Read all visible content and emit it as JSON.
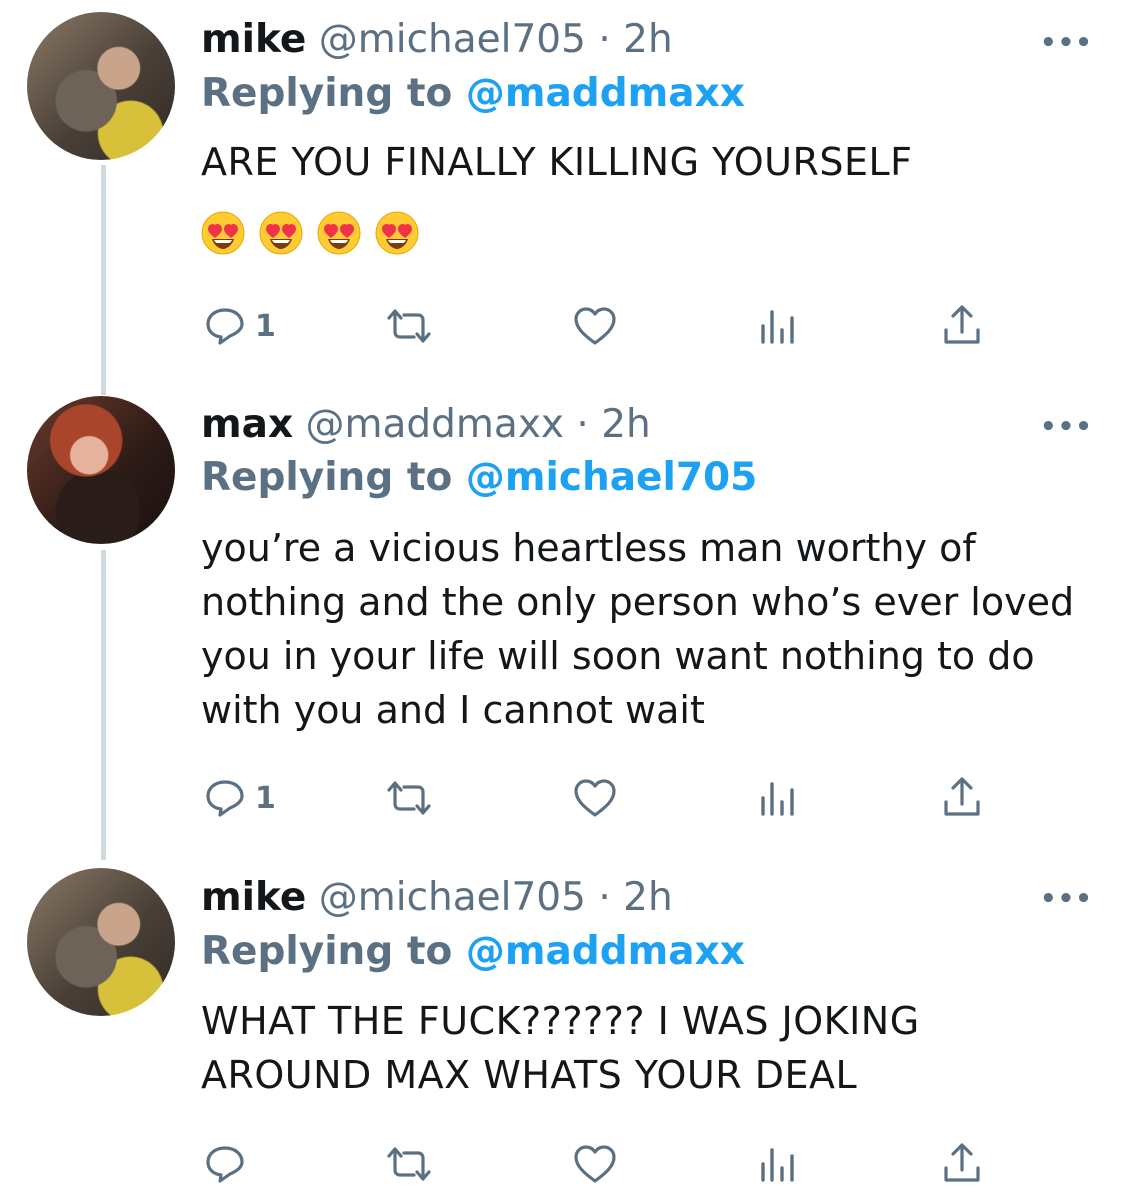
{
  "tweets": [
    {
      "name": "mike",
      "handle": "@michael705",
      "dot": "·",
      "time": "2h",
      "reply_prefix": "Replying to",
      "reply_to": "@maddmaxx",
      "text": "ARE YOU FINALLY KILLING YOURSELF",
      "emojis": [
        "smiling-face-with-heart-eyes",
        "smiling-face-with-heart-eyes",
        "smiling-face-with-heart-eyes",
        "smiling-face-with-heart-eyes"
      ],
      "reply_count": "1"
    },
    {
      "name": "max",
      "handle": "@maddmaxx",
      "dot": "·",
      "time": "2h",
      "reply_prefix": "Replying to",
      "reply_to": "@michael705",
      "text": "you’re a vicious heartless man worthy of nothing and the only person who’s ever loved you in your life will soon want nothing to do with you and I cannot wait",
      "reply_count": "1"
    },
    {
      "name": "mike",
      "handle": "@michael705",
      "dot": "·",
      "time": "2h",
      "reply_prefix": "Replying to",
      "reply_to": "@maddmaxx",
      "text": "WHAT THE FUCK?????? I WAS JOKING AROUND MAX WHATS YOUR DEAL",
      "reply_count": ""
    }
  ],
  "more_label": "•••",
  "icons": {
    "reply": "reply-icon",
    "retweet": "retweet-icon",
    "like": "heart-icon",
    "analytics": "analytics-icon",
    "share": "share-icon"
  },
  "colors": {
    "text": "#14171a",
    "secondary": "#5b7083",
    "link": "#1da1f2",
    "thread_line": "#cfd9de"
  }
}
